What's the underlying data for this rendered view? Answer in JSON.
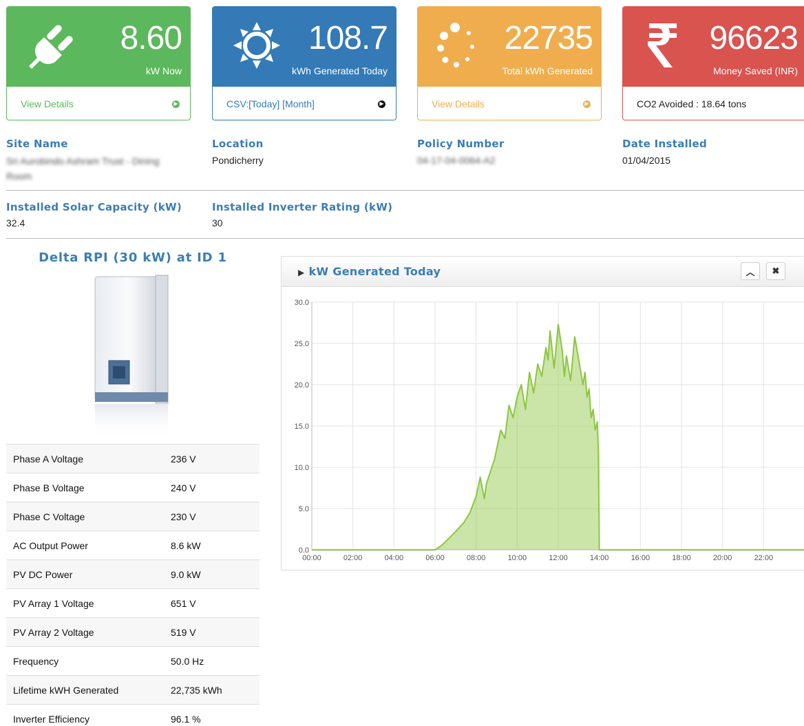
{
  "cards": {
    "kw_now": {
      "value": "8.60",
      "label": "kW Now",
      "footer": "View Details",
      "icon": "plug-icon",
      "color": "#5cb85c"
    },
    "kwh_today": {
      "value": "108.7",
      "label": "kWh Generated Today",
      "footer": "CSV:[Today] [Month]",
      "icon": "sun-icon",
      "color": "#337ab7"
    },
    "total_kwh": {
      "value": "22735",
      "label": "Total kWh Generated",
      "footer": "View Details",
      "icon": "spinner-icon",
      "color": "#f0ad4e"
    },
    "money": {
      "value": "96623",
      "label": "Money Saved (INR)",
      "footer": "CO2 Avoided : 18.64 tons",
      "icon": "rupee-icon",
      "color": "#d9534f"
    }
  },
  "info": {
    "site_name_label": "Site Name",
    "site_name_value": "Sri Aurobindo Ashram Trust - Dining Room",
    "location_label": "Location",
    "location_value": "Pondicherry",
    "policy_label": "Policy Number",
    "policy_value": "04-17-04-0064-A2",
    "date_label": "Date Installed",
    "date_value": "01/04/2015",
    "capacity_label": "Installed Solar Capacity (kW)",
    "capacity_value": "32.4",
    "inverter_label": "Installed Inverter Rating (kW)",
    "inverter_value": "30"
  },
  "inverter": {
    "title": "Delta RPI (30 kW) at ID 1",
    "stats": [
      {
        "k": "Phase A Voltage",
        "v": "236 V"
      },
      {
        "k": "Phase B Voltage",
        "v": "240 V"
      },
      {
        "k": "Phase C Voltage",
        "v": "230 V"
      },
      {
        "k": "AC Output Power",
        "v": "8.6 kW"
      },
      {
        "k": "PV DC Power",
        "v": "9.0 kW"
      },
      {
        "k": "PV Array 1 Voltage",
        "v": "651 V"
      },
      {
        "k": "PV Array 2 Voltage",
        "v": "519 V"
      },
      {
        "k": "Frequency",
        "v": "50.0 Hz"
      },
      {
        "k": "Lifetime kWH Generated",
        "v": "22,735 kWh"
      },
      {
        "k": "Inverter Efficiency",
        "v": "96.1 %"
      }
    ]
  },
  "panel": {
    "title": "kW Generated Today",
    "collapse_icon": "chevron-up-icon",
    "close_icon": "close-icon"
  },
  "chart_data": {
    "type": "area",
    "title": "kW Generated Today",
    "xlabel": "",
    "ylabel": "",
    "ylim": [
      0,
      30
    ],
    "xlim": [
      0,
      24
    ],
    "x_ticks": [
      "00:00",
      "02:00",
      "04:00",
      "06:00",
      "08:00",
      "10:00",
      "12:00",
      "14:00",
      "16:00",
      "18:00",
      "20:00",
      "22:00"
    ],
    "y_ticks": [
      "0.0",
      "5.0",
      "10.0",
      "15.0",
      "20.0",
      "25.0",
      "30.0"
    ],
    "grid": true,
    "color": "#8cc63f",
    "series": [
      {
        "x": [
          0,
          6.0,
          6.3,
          6.6,
          7.0,
          7.4,
          7.7,
          8.0,
          8.2,
          8.3,
          8.4,
          8.5,
          8.7,
          8.9,
          9.0,
          9.2,
          9.4,
          9.6,
          9.8,
          10.0,
          10.2,
          10.4,
          10.6,
          10.8,
          11.0,
          11.2,
          11.4,
          11.5,
          11.6,
          11.8,
          12.0,
          12.2,
          12.3,
          12.4,
          12.6,
          12.8,
          13.0,
          13.2,
          13.3,
          13.4,
          13.5,
          13.6,
          13.7,
          13.8,
          13.9,
          13.95,
          14.0,
          24
        ],
        "y": [
          0,
          0,
          0.5,
          1.2,
          2.2,
          3.3,
          4.5,
          6.5,
          8.8,
          7.5,
          6.2,
          8.0,
          9.5,
          11.0,
          12.2,
          14.5,
          13.5,
          17.5,
          16.0,
          18.5,
          20.0,
          17.0,
          21.5,
          19.0,
          22.5,
          21.0,
          24.5,
          23.0,
          26.5,
          22.0,
          27.3,
          24.0,
          21.0,
          23.5,
          20.5,
          25.8,
          23.0,
          20.0,
          21.5,
          18.5,
          19.5,
          16.0,
          17.0,
          14.5,
          15.5,
          12.0,
          0,
          0
        ]
      }
    ]
  }
}
